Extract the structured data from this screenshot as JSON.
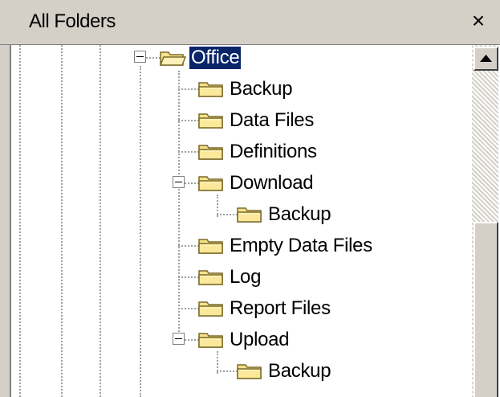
{
  "panel": {
    "title": "All Folders",
    "close_symbol": "×"
  },
  "tree": {
    "selected": "Office",
    "items": [
      {
        "label": "Office",
        "level": 0,
        "expanded": true,
        "icon": "open-folder-icon",
        "selected": true
      },
      {
        "label": "Backup",
        "level": 1,
        "icon": "folder-icon"
      },
      {
        "label": "Data Files",
        "level": 1,
        "icon": "folder-icon"
      },
      {
        "label": "Definitions",
        "level": 1,
        "icon": "folder-icon"
      },
      {
        "label": "Download",
        "level": 1,
        "expanded": true,
        "icon": "folder-icon"
      },
      {
        "label": "Backup",
        "level": 2,
        "icon": "folder-icon"
      },
      {
        "label": "Empty Data Files",
        "level": 1,
        "icon": "folder-icon"
      },
      {
        "label": "Log",
        "level": 1,
        "icon": "folder-icon"
      },
      {
        "label": "Report Files",
        "level": 1,
        "icon": "folder-icon"
      },
      {
        "label": "Upload",
        "level": 1,
        "expanded": true,
        "icon": "folder-icon"
      },
      {
        "label": "Backup",
        "level": 2,
        "icon": "folder-icon"
      }
    ]
  },
  "scrollbar": {
    "up_icon": "arrow-up-icon"
  },
  "colors": {
    "selection": "#0a246a",
    "folder": "#f6e08a",
    "folder_outline": "#7a6a2a",
    "chrome": "#d4d0c8"
  }
}
